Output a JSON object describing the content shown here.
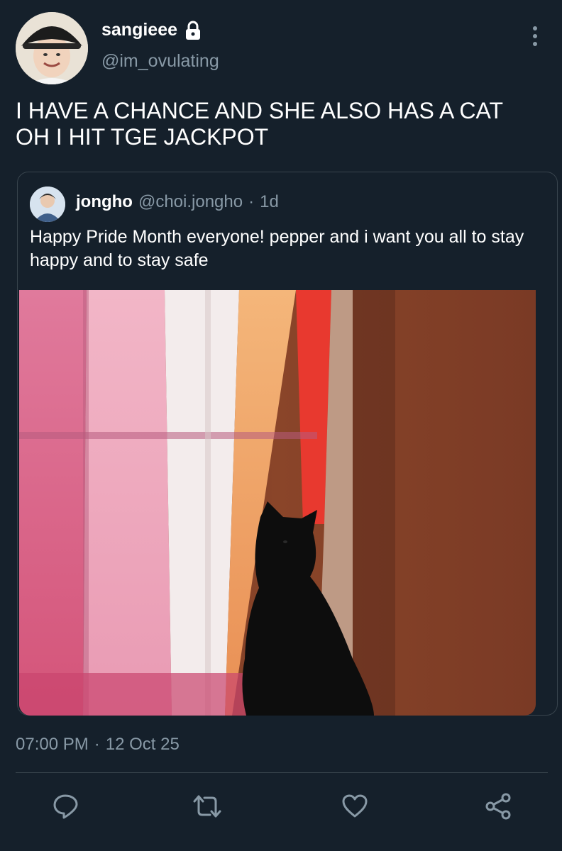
{
  "author": {
    "display_name": "sangieee",
    "handle": "@im_ovulating",
    "avatar_icon": "person-bucket-hat-avatar",
    "protected_icon": "lock-icon"
  },
  "tweet": {
    "text": "I HAVE A CHANCE AND SHE ALSO HAS A CAT\nOH I HIT TGE JACKPOT"
  },
  "quoted_tweet": {
    "display_name": "jongho",
    "handle": "@choi.jongho",
    "separator": "·",
    "age": "1d",
    "text": "Happy Pride Month everyone! pepper and i want you all to stay happy and to stay safe",
    "image_icon": "black-cat-by-pride-curtain-photo"
  },
  "meta": {
    "time": "07:00 PM",
    "separator": "·",
    "date": "12 Oct 25"
  },
  "actions": {
    "icons": [
      "reply-icon",
      "retweet-icon",
      "like-icon",
      "share-icon"
    ]
  },
  "colors": {
    "background": "#15202b",
    "secondary_text": "#8899a6",
    "border": "#38444d"
  }
}
